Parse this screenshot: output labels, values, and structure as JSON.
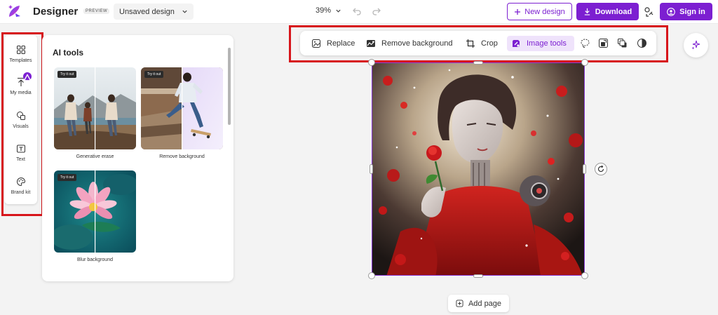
{
  "header": {
    "app_name": "Designer",
    "preview_badge": "PREVIEW",
    "doc_title": "Unsaved design",
    "zoom": "39%",
    "new_design_label": "New design",
    "download_label": "Download",
    "sign_in_label": "Sign in"
  },
  "rail": {
    "items": [
      {
        "label": "Templates",
        "icon": "templates-icon"
      },
      {
        "label": "My media",
        "icon": "upload-icon"
      },
      {
        "label": "Visuals",
        "icon": "visuals-icon"
      },
      {
        "label": "Text",
        "icon": "text-icon"
      },
      {
        "label": "Brand kit",
        "icon": "brand-kit-icon"
      }
    ]
  },
  "panel": {
    "title": "AI tools",
    "cards": [
      {
        "label": "Generative erase",
        "tag": "Try it out"
      },
      {
        "label": "Remove background",
        "tag": "Try it out"
      },
      {
        "label": "Blur background",
        "tag": "Try it out"
      }
    ]
  },
  "toolbar": {
    "replace": "Replace",
    "remove_background": "Remove background",
    "crop": "Crop",
    "image_tools": "Image tools"
  },
  "canvas": {
    "add_page": "Add page"
  },
  "colors": {
    "accent": "#7c1fd1",
    "highlight_box": "#d7151b"
  }
}
